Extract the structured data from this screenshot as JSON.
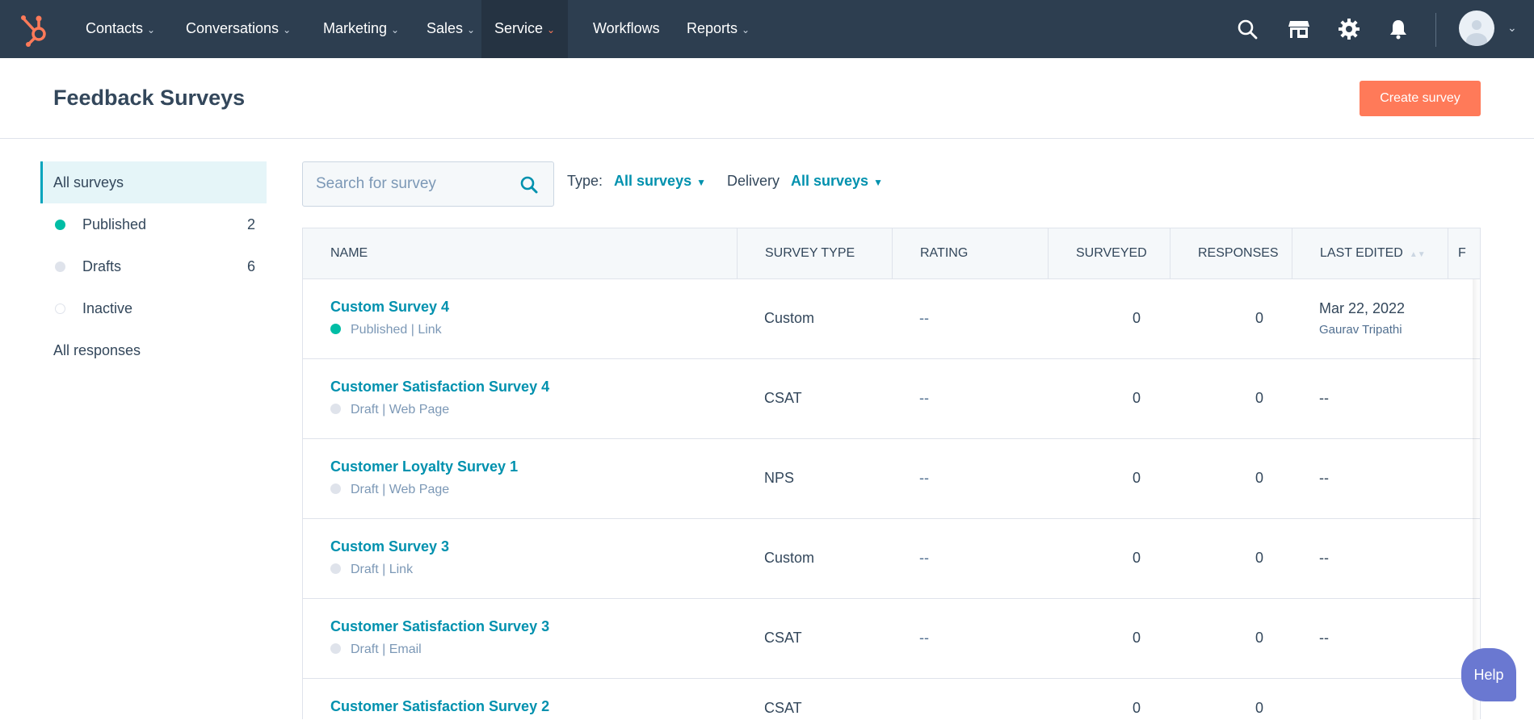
{
  "nav": {
    "items": [
      {
        "label": "Contacts",
        "dropdown": true
      },
      {
        "label": "Conversations",
        "dropdown": true
      },
      {
        "label": "Marketing",
        "dropdown": true
      },
      {
        "label": "Sales",
        "dropdown": true
      },
      {
        "label": "Service",
        "dropdown": true,
        "active": true
      },
      {
        "label": "Workflows",
        "dropdown": false
      },
      {
        "label": "Reports",
        "dropdown": true
      }
    ]
  },
  "header": {
    "title": "Feedback Surveys",
    "create_label": "Create survey"
  },
  "sidebar": {
    "items": [
      {
        "label": "All surveys",
        "active": true
      },
      {
        "label": "Published",
        "count": "2",
        "dot": "#00bda5"
      },
      {
        "label": "Drafts",
        "count": "6",
        "dot": "#dfe3eb"
      },
      {
        "label": "Inactive",
        "dot": "hollow"
      },
      {
        "label": "All responses"
      }
    ]
  },
  "search": {
    "placeholder": "Search for survey",
    "value": ""
  },
  "filters": {
    "type_label": "Type:",
    "type_value": "All surveys",
    "delivery_label": "Delivery",
    "delivery_value": "All surveys"
  },
  "table": {
    "headers": [
      "NAME",
      "SURVEY TYPE",
      "RATING",
      "SURVEYED",
      "RESPONSES",
      "LAST EDITED",
      "F"
    ],
    "rows": [
      {
        "name": "Custom Survey 4",
        "status": "Published | Link",
        "published": true,
        "type": "Custom",
        "rating": "--",
        "surveyed": "0",
        "responses": "0",
        "last_edited": "Mar 22, 2022",
        "edited_by": "Gaurav Tripathi"
      },
      {
        "name": "Customer Satisfaction Survey 4",
        "status": "Draft | Web Page",
        "published": false,
        "type": "CSAT",
        "rating": "--",
        "surveyed": "0",
        "responses": "0",
        "last_edited": "--",
        "edited_by": ""
      },
      {
        "name": "Customer Loyalty Survey 1",
        "status": "Draft | Web Page",
        "published": false,
        "type": "NPS",
        "rating": "--",
        "surveyed": "0",
        "responses": "0",
        "last_edited": "--",
        "edited_by": ""
      },
      {
        "name": "Custom Survey 3",
        "status": "Draft | Link",
        "published": false,
        "type": "Custom",
        "rating": "--",
        "surveyed": "0",
        "responses": "0",
        "last_edited": "--",
        "edited_by": ""
      },
      {
        "name": "Customer Satisfaction Survey 3",
        "status": "Draft | Email",
        "published": false,
        "type": "CSAT",
        "rating": "--",
        "surveyed": "0",
        "responses": "0",
        "last_edited": "--",
        "edited_by": ""
      },
      {
        "name": "Customer Satisfaction Survey 2",
        "status": "",
        "published": false,
        "type": "CSAT",
        "rating": "",
        "surveyed": "0",
        "responses": "0",
        "last_edited": "",
        "edited_by": ""
      }
    ]
  },
  "help": {
    "label": "Help"
  },
  "colors": {
    "nav_bg": "#2d3e50",
    "accent": "#ff7a59",
    "link": "#0091ae",
    "published": "#00bda5"
  }
}
